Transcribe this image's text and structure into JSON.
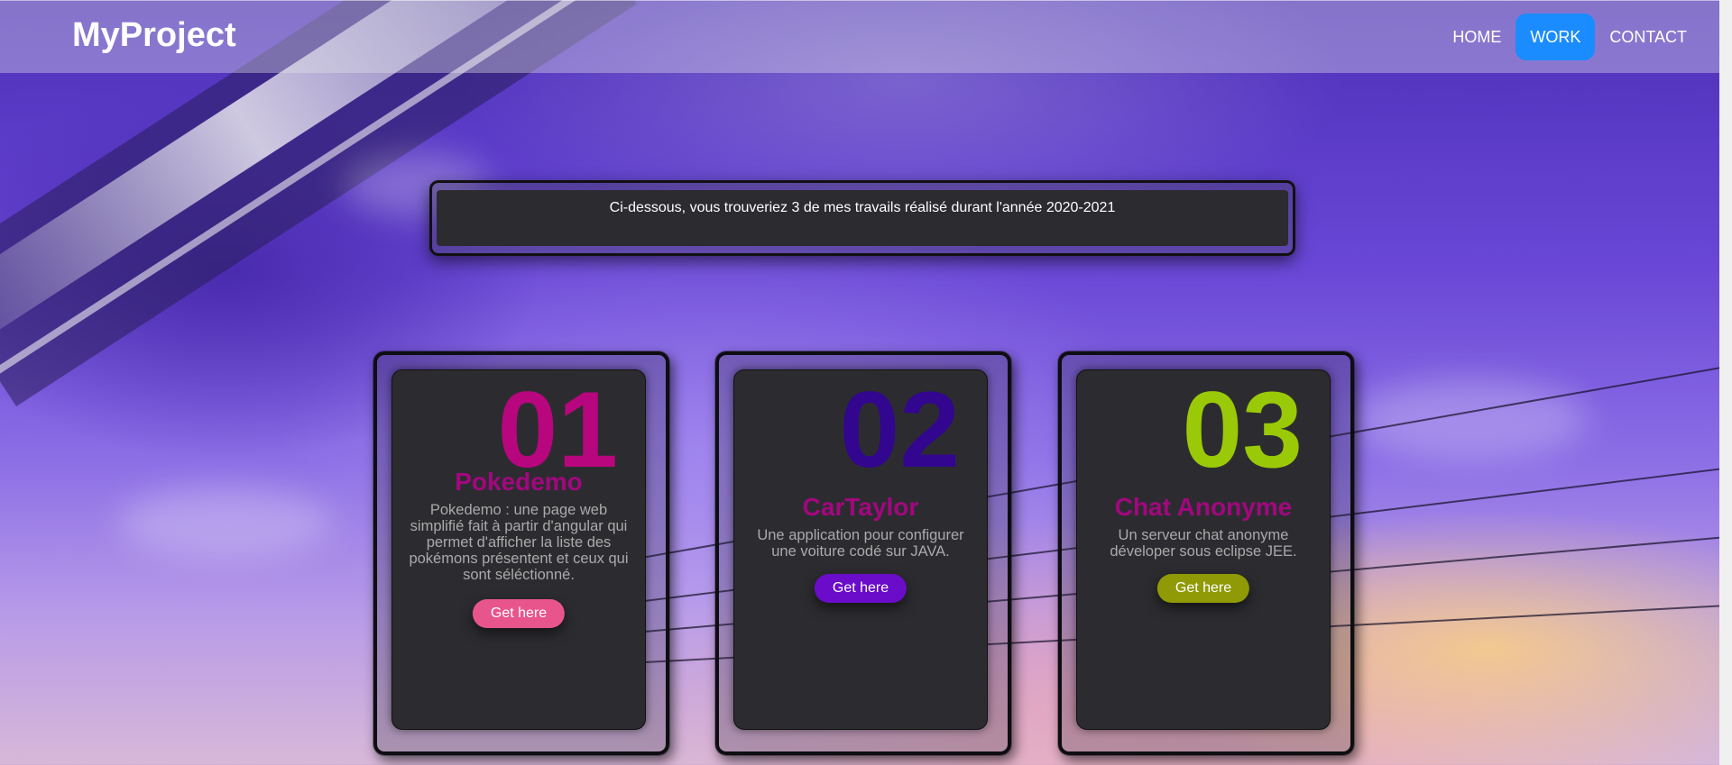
{
  "header": {
    "brand": "MyProject",
    "nav": [
      {
        "label": "HOME"
      },
      {
        "label": "WORK",
        "active": true
      },
      {
        "label": "CONTACT"
      }
    ],
    "active_color": "#1a8cff"
  },
  "intro": {
    "text": "Ci-dessous, vous trouveriez 3 de mes travails réalisé durant l'année 2020-2021"
  },
  "cards": [
    {
      "number": "01",
      "number_color": "#b8067f",
      "title": "Pokedemo",
      "description": "Pokedemo : une page web simplifié fait à partir d'angular qui permet d'afficher la liste des pokémons présentent et ceux qui sont séléctionné.",
      "button_label": "Get here",
      "button_color": "#e8558c"
    },
    {
      "number": "02",
      "number_color": "#32068f",
      "title": "CarTaylor",
      "description": "Une application pour configurer une voiture codé sur JAVA.",
      "button_label": "Get here",
      "button_color": "#6a0cc9"
    },
    {
      "number": "03",
      "number_color": "#9ac907",
      "title": "Chat Anonyme",
      "description": "Un serveur chat anonyme déveloper sous eclipse JEE.",
      "button_label": "Get here",
      "button_color": "#8f9a06"
    }
  ]
}
